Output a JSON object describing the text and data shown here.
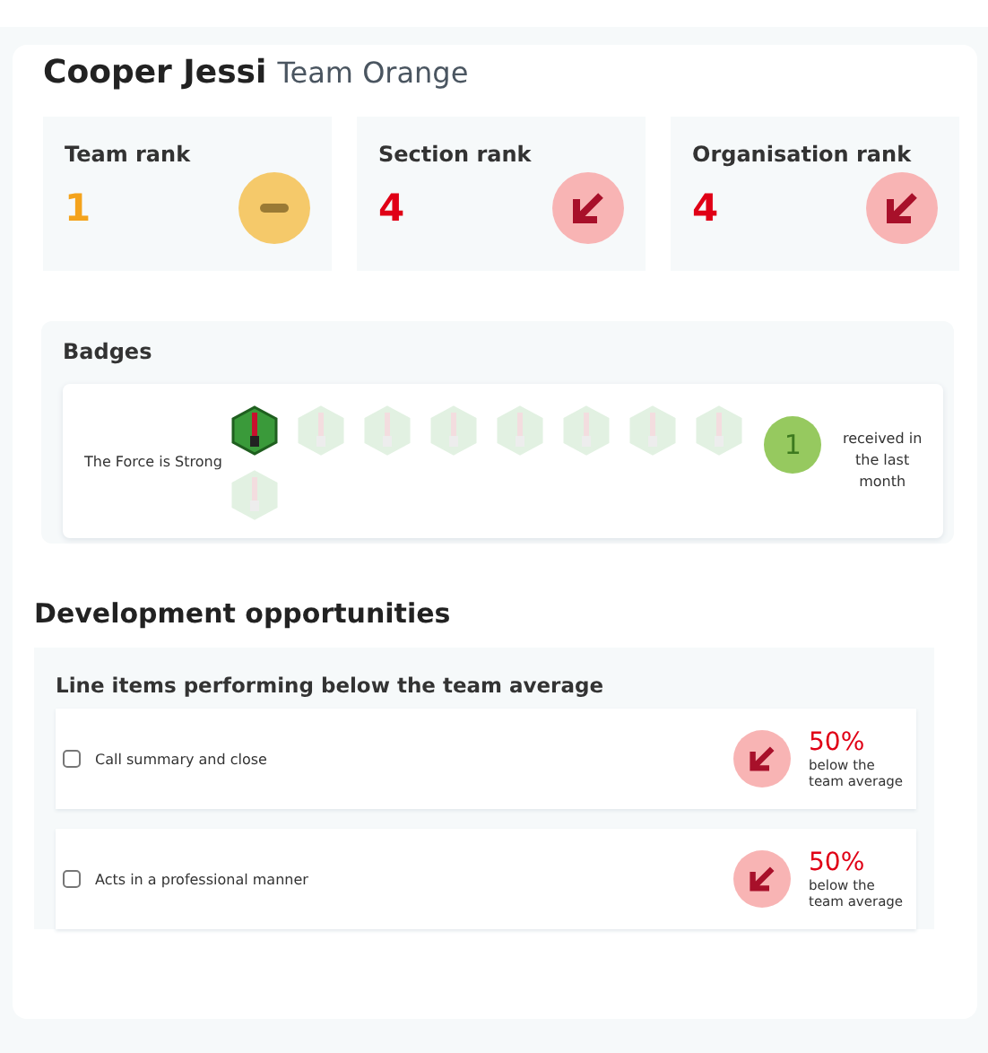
{
  "person": {
    "name": "Cooper Jessi",
    "team": "Team Orange"
  },
  "ranks": [
    {
      "label": "Team rank",
      "value": "1",
      "kind": "same"
    },
    {
      "label": "Section rank",
      "value": "4",
      "kind": "down"
    },
    {
      "label": "Organisation rank",
      "value": "4",
      "kind": "down"
    }
  ],
  "badges": {
    "title": "Badges",
    "name": "The Force is Strong",
    "items": [
      {
        "earned": true
      },
      {
        "earned": false
      },
      {
        "earned": false
      },
      {
        "earned": false
      },
      {
        "earned": false
      },
      {
        "earned": false
      },
      {
        "earned": false
      },
      {
        "earned": false
      },
      {
        "earned": false
      }
    ],
    "count": "1",
    "count_label": "received in the last month"
  },
  "development": {
    "title": "Development opportunities",
    "subtitle": "Line items performing below the team average",
    "items": [
      {
        "label": "Call summary and close",
        "checked": false,
        "percent": "50%",
        "note": "below the team average"
      },
      {
        "label": "Acts in a professional manner",
        "checked": false,
        "percent": "50%",
        "note": "below the team average"
      }
    ]
  }
}
